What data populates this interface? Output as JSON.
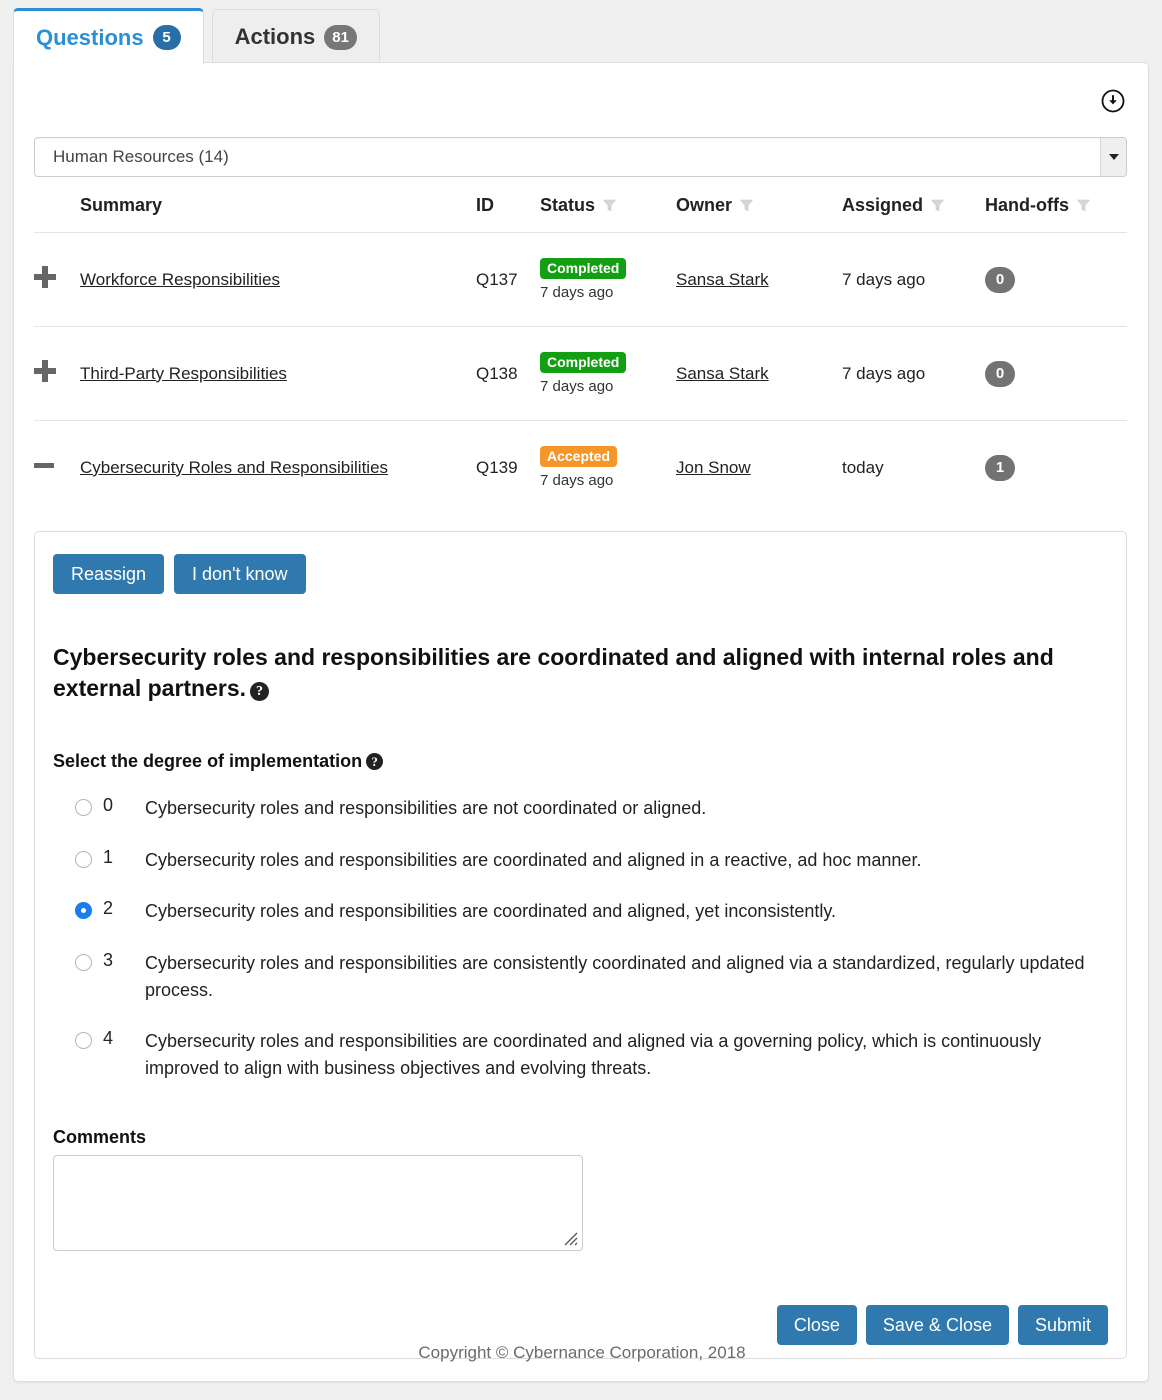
{
  "tabs": [
    {
      "label": "Questions",
      "badge": "5",
      "active": true
    },
    {
      "label": "Actions",
      "badge": "81",
      "active": false
    }
  ],
  "toolbar": {
    "download_icon": "download-circle-icon"
  },
  "filter_select": {
    "value": "Human Resources (14)",
    "arrow_icon": "caret-down-icon"
  },
  "table": {
    "columns": [
      "Summary",
      "ID",
      "Status",
      "Owner",
      "Assigned",
      "Hand-offs"
    ],
    "filterable": [
      false,
      false,
      true,
      true,
      true,
      true
    ],
    "rows": [
      {
        "expander": "plus",
        "summary": "Workforce Responsibilities",
        "id": "Q137",
        "status": "Completed",
        "status_color": "#12a012",
        "status_time": "7 days ago",
        "owner": "Sansa Stark",
        "assigned": "7 days ago",
        "handoffs": "0"
      },
      {
        "expander": "plus",
        "summary": "Third-Party Responsibilities",
        "id": "Q138",
        "status": "Completed",
        "status_color": "#12a012",
        "status_time": "7 days ago",
        "owner": "Sansa Stark",
        "assigned": "7 days ago",
        "handoffs": "0"
      },
      {
        "expander": "minus",
        "summary": "Cybersecurity Roles and Responsibilities",
        "id": "Q139",
        "status": "Accepted",
        "status_color": "#f5962a",
        "status_time": "7 days ago",
        "owner": "Jon Snow",
        "assigned": "today",
        "handoffs": "1"
      }
    ]
  },
  "detail": {
    "reassign_label": "Reassign",
    "dont_know_label": "I don't know",
    "question_text": "Cybersecurity roles and responsibilities are coordinated and aligned with internal roles and external partners.",
    "question_help_icon": "help-circle-icon",
    "degree_label": "Select the degree of implementation",
    "degree_help_icon": "help-circle-icon",
    "selected_value": "2",
    "options": [
      {
        "value": "0",
        "text": "Cybersecurity roles and responsibilities are not coordinated or aligned."
      },
      {
        "value": "1",
        "text": "Cybersecurity roles and responsibilities are coordinated and aligned in a reactive, ad hoc manner."
      },
      {
        "value": "2",
        "text": "Cybersecurity roles and responsibilities are coordinated and aligned, yet inconsistently."
      },
      {
        "value": "3",
        "text": "Cybersecurity roles and responsibilities are consistently coordinated and aligned via a standardized, regularly updated process."
      },
      {
        "value": "4",
        "text": "Cybersecurity roles and responsibilities are coordinated and aligned via a governing policy, which is continuously improved to align with business objectives and evolving threats."
      }
    ],
    "comments_label": "Comments",
    "comments_value": "",
    "comments_placeholder": "",
    "close_label": "Close",
    "save_close_label": "Save & Close",
    "submit_label": "Submit"
  },
  "footer": {
    "copyright": "Copyright © Cybernance Corporation, 2018"
  },
  "colors": {
    "accent_blue": "#2a8fd4",
    "button_blue": "#3079ae",
    "badge_green": "#12a012",
    "badge_orange": "#f5962a",
    "badge_gray": "#737373",
    "radio_blue": "#1b7ced",
    "page_bg": "#f0f0f0"
  }
}
